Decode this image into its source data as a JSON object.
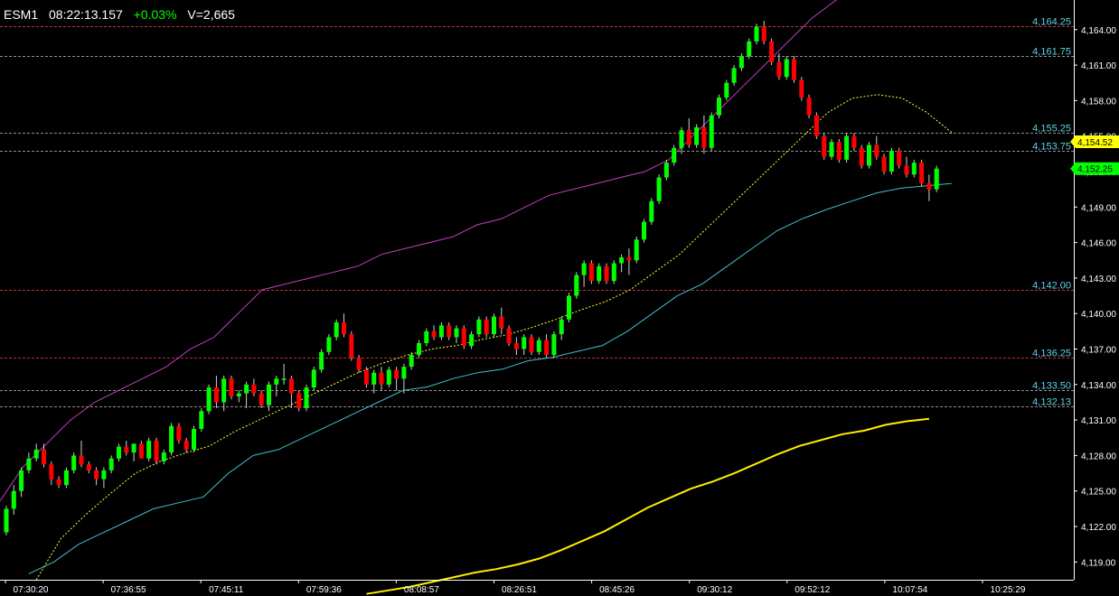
{
  "header": {
    "symbol": "ESM1",
    "time": "08:22:13.157",
    "change": "+0.03%",
    "volume": "V=2,665"
  },
  "colors": {
    "up": "#00ff00",
    "down": "#ff0000",
    "upper_band": "#c040c0",
    "lower_band": "#40c0d0",
    "middle_dashed": "#ffff40",
    "slow_ma": "#ffee00",
    "level_line": "#c03030",
    "level_line_alt": "#909090",
    "level_label": "#5fd3e8",
    "last_price_bg": "#ffff00",
    "bid_price_bg": "#00ff00"
  },
  "chart_data": {
    "type": "candlestick",
    "ylim": [
      4117.5,
      4166.5
    ],
    "y_ticks": [
      "4,164.00",
      "4,161.00",
      "4,158.00",
      "4,155.00",
      "4,152.00",
      "4,149.00",
      "4,146.00",
      "4,143.00",
      "4,140.00",
      "4,137.00",
      "4,134.00",
      "4,131.00",
      "4,128.00",
      "4,125.00",
      "4,122.00",
      "4,119.00"
    ],
    "y_tick_values": [
      4164,
      4161,
      4158,
      4155,
      4152,
      4149,
      4146,
      4143,
      4140,
      4137,
      4134,
      4131,
      4128,
      4125,
      4122,
      4119
    ],
    "x_ticks": [
      "07:30:20",
      "07:36:55",
      "07:45:11",
      "07:59:36",
      "08:08:57",
      "08:26:51",
      "08:45:26",
      "09:30:12",
      "09:52:12",
      "10:07:54",
      "10:25:29"
    ],
    "levels": [
      {
        "label": "4,164.25",
        "value": 4164.25,
        "style": "red"
      },
      {
        "label": "4,161.75",
        "value": 4161.75,
        "style": "gray"
      },
      {
        "label": "4,155.25",
        "value": 4155.25,
        "style": "gray"
      },
      {
        "label": "4,153.75",
        "value": 4153.75,
        "style": "gray"
      },
      {
        "label": "4,142.00",
        "value": 4142.0,
        "style": "red"
      },
      {
        "label": "4,136.25",
        "value": 4136.25,
        "style": "red"
      },
      {
        "label": "4,133.50",
        "value": 4133.5,
        "style": "gray"
      },
      {
        "label": "4,132.13",
        "value": 4132.13,
        "style": "gray"
      }
    ],
    "last_price": {
      "label": "4,154.52",
      "value": 4154.52
    },
    "bid_price": {
      "label": "4,152.25",
      "value": 4152.25
    },
    "candles": [
      [
        4121.5,
        4123.75,
        4121.25,
        4123.5
      ],
      [
        4123.5,
        4125.5,
        4123.0,
        4125.0
      ],
      [
        4125.0,
        4127.0,
        4124.5,
        4126.75
      ],
      [
        4126.75,
        4128.25,
        4126.5,
        4127.75
      ],
      [
        4127.75,
        4129.0,
        4127.5,
        4128.5
      ],
      [
        4128.5,
        4129.0,
        4127.0,
        4127.25
      ],
      [
        4127.25,
        4127.5,
        4125.5,
        4126.0
      ],
      [
        4126.0,
        4126.25,
        4125.25,
        4125.5
      ],
      [
        4125.5,
        4127.0,
        4125.25,
        4126.75
      ],
      [
        4126.75,
        4128.25,
        4126.5,
        4128.0
      ],
      [
        4128.0,
        4129.25,
        4127.0,
        4127.25
      ],
      [
        4127.25,
        4127.5,
        4126.5,
        4126.75
      ],
      [
        4126.75,
        4127.0,
        4125.5,
        4126.0
      ],
      [
        4126.0,
        4127.0,
        4125.25,
        4126.75
      ],
      [
        4126.75,
        4128.0,
        4126.5,
        4127.75
      ],
      [
        4127.75,
        4129.0,
        4127.5,
        4128.75
      ],
      [
        4128.75,
        4129.25,
        4128.0,
        4128.25
      ],
      [
        4128.25,
        4129.0,
        4127.5,
        4129.0
      ],
      [
        4129.0,
        4129.25,
        4127.75,
        4127.75
      ],
      [
        4127.75,
        4129.5,
        4127.5,
        4129.25
      ],
      [
        4129.25,
        4129.5,
        4127.25,
        4127.5
      ],
      [
        4127.5,
        4128.5,
        4127.25,
        4128.25
      ],
      [
        4128.25,
        4130.75,
        4128.0,
        4130.5
      ],
      [
        4130.5,
        4130.75,
        4129.0,
        4129.25
      ],
      [
        4129.25,
        4129.5,
        4128.25,
        4128.5
      ],
      [
        4128.5,
        4130.5,
        4128.25,
        4130.25
      ],
      [
        4130.25,
        4132.0,
        4130.0,
        4131.75
      ],
      [
        4131.75,
        4134.0,
        4131.5,
        4133.75
      ],
      [
        4133.75,
        4134.75,
        4132.0,
        4132.5
      ],
      [
        4132.5,
        4134.75,
        4131.75,
        4134.5
      ],
      [
        4134.5,
        4134.75,
        4132.75,
        4133.0
      ],
      [
        4133.0,
        4133.5,
        4132.5,
        4133.25
      ],
      [
        4133.25,
        4134.25,
        4132.0,
        4134.0
      ],
      [
        4134.0,
        4134.5,
        4133.0,
        4133.25
      ],
      [
        4133.25,
        4133.5,
        4132.0,
        4132.25
      ],
      [
        4132.25,
        4134.25,
        4131.75,
        4134.0
      ],
      [
        4134.0,
        4134.75,
        4133.0,
        4134.5
      ],
      [
        4134.5,
        4135.75,
        4134.0,
        4134.5
      ],
      [
        4134.5,
        4134.75,
        4132.0,
        4133.25
      ],
      [
        4133.25,
        4133.5,
        4131.75,
        4132.0
      ],
      [
        4132.0,
        4134.0,
        4131.75,
        4133.75
      ],
      [
        4133.75,
        4135.5,
        4133.5,
        4135.25
      ],
      [
        4135.25,
        4137.0,
        4135.0,
        4136.75
      ],
      [
        4136.75,
        4138.25,
        4136.5,
        4138.0
      ],
      [
        4138.0,
        4139.5,
        4137.75,
        4139.25
      ],
      [
        4139.25,
        4140.0,
        4138.0,
        4138.25
      ],
      [
        4138.25,
        4138.5,
        4136.0,
        4136.25
      ],
      [
        4136.25,
        4136.5,
        4135.0,
        4135.25
      ],
      [
        4135.25,
        4135.5,
        4133.75,
        4134.0
      ],
      [
        4134.0,
        4135.25,
        4133.25,
        4135.0
      ],
      [
        4135.0,
        4135.5,
        4133.5,
        4134.0
      ],
      [
        4134.0,
        4135.5,
        4133.75,
        4135.25
      ],
      [
        4135.25,
        4135.5,
        4133.5,
        4134.5
      ],
      [
        4134.5,
        4135.75,
        4133.25,
        4135.5
      ],
      [
        4135.5,
        4136.75,
        4135.25,
        4136.5
      ],
      [
        4136.5,
        4137.75,
        4136.25,
        4137.5
      ],
      [
        4137.5,
        4138.75,
        4137.25,
        4138.5
      ],
      [
        4138.5,
        4139.0,
        4137.75,
        4138.0
      ],
      [
        4138.0,
        4139.25,
        4137.75,
        4139.0
      ],
      [
        4139.0,
        4139.25,
        4137.75,
        4138.0
      ],
      [
        4138.0,
        4139.0,
        4137.5,
        4138.75
      ],
      [
        4138.75,
        4139.0,
        4137.0,
        4137.25
      ],
      [
        4137.25,
        4138.5,
        4137.0,
        4138.25
      ],
      [
        4138.25,
        4139.75,
        4138.0,
        4139.5
      ],
      [
        4139.5,
        4139.75,
        4138.0,
        4138.25
      ],
      [
        4138.25,
        4140.0,
        4138.0,
        4139.75
      ],
      [
        4139.75,
        4140.5,
        4138.25,
        4138.75
      ],
      [
        4138.75,
        4139.0,
        4137.25,
        4137.5
      ],
      [
        4137.5,
        4138.0,
        4136.5,
        4137.0
      ],
      [
        4137.0,
        4138.25,
        4136.5,
        4138.0
      ],
      [
        4138.0,
        4138.25,
        4136.5,
        4136.75
      ],
      [
        4136.75,
        4138.0,
        4136.5,
        4137.75
      ],
      [
        4137.75,
        4138.25,
        4136.25,
        4136.5
      ],
      [
        4136.5,
        4138.5,
        4136.25,
        4138.25
      ],
      [
        4138.25,
        4139.75,
        4137.75,
        4139.5
      ],
      [
        4139.5,
        4141.75,
        4139.25,
        4141.5
      ],
      [
        4141.5,
        4143.5,
        4141.25,
        4143.25
      ],
      [
        4143.25,
        4144.5,
        4142.25,
        4144.25
      ],
      [
        4144.25,
        4144.5,
        4142.5,
        4142.75
      ],
      [
        4142.75,
        4144.25,
        4142.5,
        4144.0
      ],
      [
        4144.0,
        4144.25,
        4142.5,
        4142.75
      ],
      [
        4142.75,
        4144.5,
        4142.5,
        4144.25
      ],
      [
        4144.25,
        4145.0,
        4143.5,
        4144.75
      ],
      [
        4144.75,
        4145.5,
        4143.25,
        4144.5
      ],
      [
        4144.5,
        4146.5,
        4144.25,
        4146.25
      ],
      [
        4146.25,
        4148.0,
        4146.0,
        4147.75
      ],
      [
        4147.75,
        4149.75,
        4147.5,
        4149.5
      ],
      [
        4149.5,
        4151.75,
        4149.25,
        4151.5
      ],
      [
        4151.5,
        4153.0,
        4151.25,
        4152.75
      ],
      [
        4152.75,
        4154.25,
        4152.5,
        4154.0
      ],
      [
        4154.0,
        4155.75,
        4153.5,
        4155.5
      ],
      [
        4155.5,
        4156.5,
        4154.0,
        4154.25
      ],
      [
        4154.25,
        4156.0,
        4154.0,
        4155.75
      ],
      [
        4155.75,
        4156.75,
        4153.5,
        4154.0
      ],
      [
        4154.0,
        4157.0,
        4153.75,
        4156.75
      ],
      [
        4156.75,
        4158.5,
        4156.5,
        4158.25
      ],
      [
        4158.25,
        4159.75,
        4158.0,
        4159.5
      ],
      [
        4159.5,
        4161.0,
        4159.25,
        4160.75
      ],
      [
        4160.75,
        4162.0,
        4160.5,
        4161.75
      ],
      [
        4161.75,
        4163.25,
        4161.5,
        4163.0
      ],
      [
        4163.0,
        4164.5,
        4162.75,
        4164.25
      ],
      [
        4164.25,
        4164.75,
        4162.75,
        4163.0
      ],
      [
        4163.0,
        4163.25,
        4161.0,
        4161.25
      ],
      [
        4161.25,
        4162.0,
        4159.75,
        4160.0
      ],
      [
        4160.0,
        4161.75,
        4159.75,
        4161.5
      ],
      [
        4161.5,
        4161.75,
        4159.5,
        4159.75
      ],
      [
        4159.75,
        4160.0,
        4158.0,
        4158.25
      ],
      [
        4158.25,
        4158.5,
        4156.5,
        4156.75
      ],
      [
        4156.75,
        4157.0,
        4154.75,
        4155.0
      ],
      [
        4155.0,
        4155.25,
        4153.0,
        4153.25
      ],
      [
        4153.25,
        4154.75,
        4153.0,
        4154.5
      ],
      [
        4154.5,
        4154.75,
        4152.75,
        4153.0
      ],
      [
        4153.0,
        4155.25,
        4152.75,
        4155.0
      ],
      [
        4155.0,
        4155.25,
        4153.75,
        4154.0
      ],
      [
        4154.0,
        4154.25,
        4152.25,
        4152.5
      ],
      [
        4152.5,
        4154.5,
        4152.25,
        4154.25
      ],
      [
        4154.25,
        4155.0,
        4153.0,
        4153.25
      ],
      [
        4153.25,
        4153.5,
        4151.75,
        4152.0
      ],
      [
        4152.0,
        4154.0,
        4151.75,
        4153.75
      ],
      [
        4153.75,
        4154.0,
        4152.25,
        4152.5
      ],
      [
        4152.5,
        4153.25,
        4151.5,
        4151.75
      ],
      [
        4151.75,
        4153.0,
        4151.5,
        4152.75
      ],
      [
        4152.75,
        4153.0,
        4150.75,
        4151.0
      ],
      [
        4151.0,
        4151.75,
        4149.5,
        4150.5
      ],
      [
        4150.5,
        4152.5,
        4150.25,
        4152.25
      ]
    ],
    "upper_band": [
      4124,
      4127,
      4129,
      4131,
      4132.5,
      4133.5,
      4134.5,
      4135.5,
      4137,
      4138,
      4140,
      4142,
      4142.5,
      4143,
      4143.5,
      4144,
      4145,
      4145.5,
      4146,
      4146.5,
      4147.5,
      4148,
      4149,
      4150,
      4150.5,
      4151,
      4151.5,
      4152,
      4153,
      4155,
      4157,
      4159,
      4161,
      4163,
      4165,
      4166.5,
      4167.5,
      4168.5
    ],
    "lower_band": [
      4118,
      4119,
      4120.5,
      4121.5,
      4122.5,
      4123.5,
      4124,
      4124.5,
      4126.5,
      4128,
      4128.5,
      4129.5,
      4130.5,
      4131.5,
      4132.5,
      4133.5,
      4133.8,
      4134.5,
      4135,
      4135.3,
      4136,
      4136.3,
      4136.8,
      4137.3,
      4138.5,
      4140,
      4141.5,
      4142.5,
      4144,
      4145.5,
      4147,
      4148,
      4148.8,
      4149.5,
      4150.2,
      4150.6,
      4150.8,
      4151
    ],
    "middle_line": [
      4117.5,
      4121,
      4123,
      4124.8,
      4126.5,
      4127.5,
      4128.2,
      4128.8,
      4130,
      4131,
      4132,
      4133,
      4134,
      4135,
      4135.8,
      4136.5,
      4137,
      4137.3,
      4137.8,
      4138.2,
      4138.8,
      4139.5,
      4140.3,
      4141,
      4142,
      4143.5,
      4145,
      4147,
      4149,
      4151,
      4153,
      4155,
      4157,
      4158.2,
      4158.5,
      4158.2,
      4157,
      4155.3
    ],
    "slow_ma": [
      4116.3,
      4116.6,
      4116.9,
      4117.3,
      4117.7,
      4118.1,
      4118.4,
      4118.8,
      4119.3,
      4120.0,
      4120.8,
      4121.6,
      4122.6,
      4123.6,
      4124.4,
      4125.2,
      4125.8,
      4126.5,
      4127.3,
      4128.1,
      4128.8,
      4129.3,
      4129.8,
      4130.1,
      4130.6,
      4130.9,
      4131.1
    ],
    "slow_ma_start": 11.0
  }
}
